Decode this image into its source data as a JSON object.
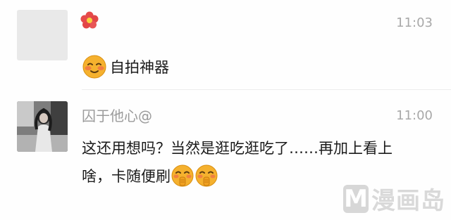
{
  "messages": [
    {
      "avatar": "blank-gray-avatar",
      "sender_icon": "red-flower-icon",
      "time": "11:03",
      "emoji": "blushing-smile-emoji",
      "text": "自拍神器"
    },
    {
      "avatar": "girl-photo-avatar",
      "sender": "囚于他心@",
      "time": "11:00",
      "line1": "这还用想吗？当然是逛吃逛吃了……再加上看上",
      "line2": "啥，卡随便刷",
      "emojis": [
        "shush-emoji",
        "shush-emoji"
      ]
    }
  ],
  "watermark": {
    "logo_letter": "M",
    "text": "漫画岛"
  },
  "colors": {
    "time": "#a8a8a8",
    "sender": "#9b9b9b",
    "text": "#1b1b1b",
    "emoji_yellow": "#f5b12e",
    "flower_red": "#e64a4a"
  }
}
